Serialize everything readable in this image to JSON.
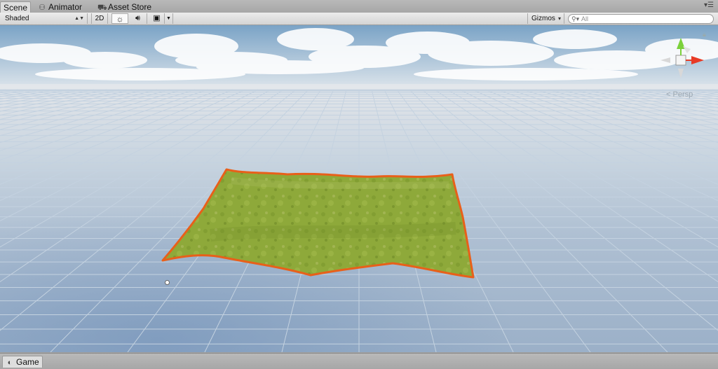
{
  "tabs": {
    "scene": "Scene",
    "animator": "Animator",
    "asset_store": "Asset Store",
    "game": "Game"
  },
  "toolbar": {
    "shading_mode": "Shaded",
    "mode_2d": "2D",
    "gizmos": "Gizmos",
    "search_placeholder": "All"
  },
  "gizmo": {
    "projection": "Persp"
  },
  "colors": {
    "selection_outline": "#e8601a",
    "terrain": "#8ea93a",
    "axis_y": "#7bd13b",
    "axis_x": "#e83a25"
  }
}
